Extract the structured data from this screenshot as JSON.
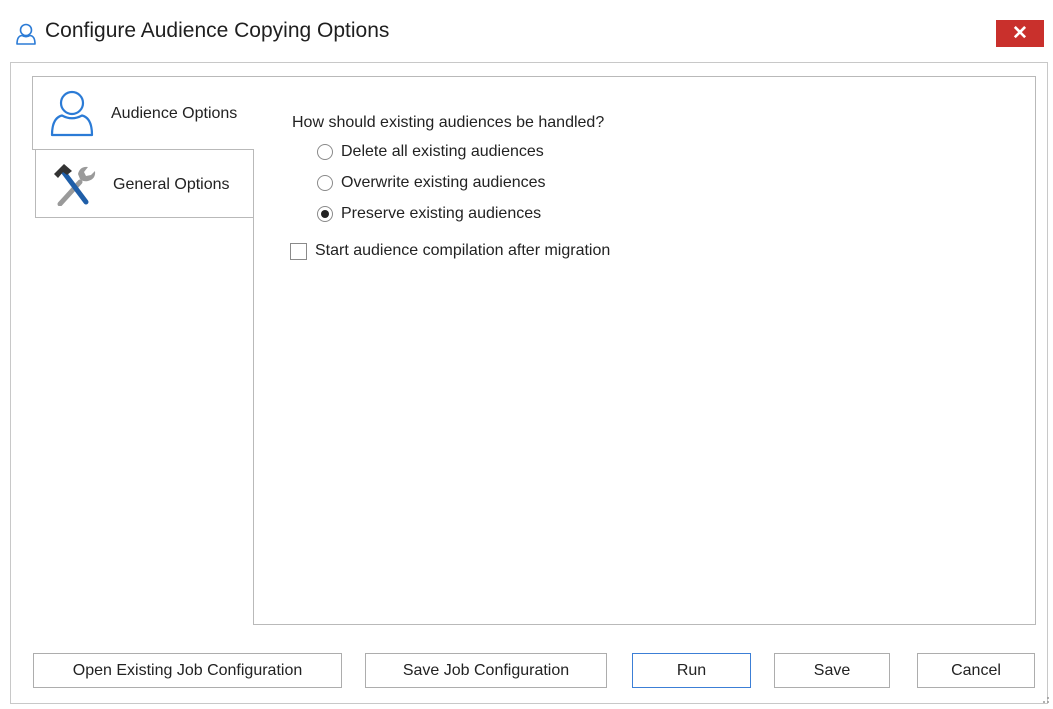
{
  "window": {
    "title": "Configure Audience Copying Options",
    "close_label": "✕",
    "accent_color": "#2b7bd6",
    "close_color": "#c9302c"
  },
  "tabs": [
    {
      "label": "Audience Options",
      "icon": "person-outline-icon",
      "selected": true
    },
    {
      "label": "General Options",
      "icon": "hammer-wrench-icon",
      "selected": false
    }
  ],
  "audience_options": {
    "question": "How should existing audiences be handled?",
    "radio_options": [
      {
        "label": "Delete all existing audiences",
        "selected": false
      },
      {
        "label": "Overwrite existing audiences",
        "selected": false
      },
      {
        "label": "Preserve existing audiences",
        "selected": true
      }
    ],
    "compile_checkbox": {
      "label": "Start audience compilation after migration",
      "checked": false
    }
  },
  "buttons": {
    "open_existing": "Open Existing Job Configuration",
    "save_job": "Save Job Configuration",
    "run": "Run",
    "save": "Save",
    "cancel": "Cancel"
  }
}
